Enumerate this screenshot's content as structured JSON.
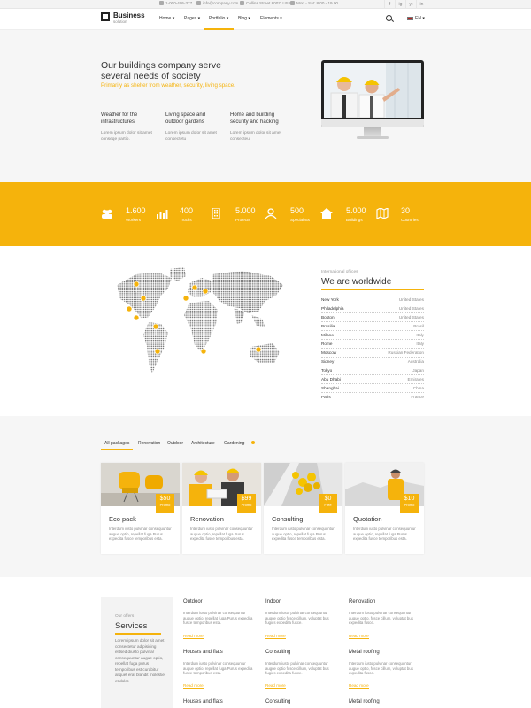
{
  "topbar": {
    "phone": "1-000-405-377",
    "email": "info@company.com",
    "address": "Collins Street 8007, USA",
    "hours": "Mon - Sat: 8.00 - 19.00",
    "social": [
      "f",
      "ig",
      "yt",
      "in"
    ]
  },
  "nav": {
    "logo_name": "Business",
    "logo_sub": "solution",
    "items": [
      "Home",
      "Pages",
      "Portfolio",
      "Blog",
      "Elements"
    ],
    "lang": "EN"
  },
  "hero": {
    "title": "Our buildings company serve several needs of society",
    "subtitle": "Primarily as shelter from weather, security, living space.",
    "features": [
      {
        "title": "Weather for the infrastructures",
        "text": "Lorem ipsum dolor sit amet conseqe partio."
      },
      {
        "title": "Living space and outdoor gardens",
        "text": "Lorem ipsum dolor sit amet consectetu"
      },
      {
        "title": "Home and building security and hacking",
        "text": "Lorem ipsum dolor sit amet consecteu"
      }
    ]
  },
  "stats": [
    {
      "value": "1.600",
      "label": "Workers"
    },
    {
      "value": "400",
      "label": "Trucks"
    },
    {
      "value": "5.000",
      "label": "Projects"
    },
    {
      "value": "500",
      "label": "Specialists"
    },
    {
      "value": "5.000",
      "label": "Buildings"
    },
    {
      "value": "30",
      "label": "Countries"
    }
  ],
  "offices": {
    "small": "International offices",
    "title": "We are worldwide",
    "rows": [
      {
        "city": "New York",
        "country": "United States"
      },
      {
        "city": "Philadelphia",
        "country": "United States"
      },
      {
        "city": "Boston",
        "country": "United States"
      },
      {
        "city": "Brasilia",
        "country": "Brasil"
      },
      {
        "city": "Milano",
        "country": "Italy"
      },
      {
        "city": "Rome",
        "country": "Italy"
      },
      {
        "city": "Moscow",
        "country": "Russian Federation"
      },
      {
        "city": "Sidney",
        "country": "Australia"
      },
      {
        "city": "Tokyo",
        "country": "Japan"
      },
      {
        "city": "Abu Dhabi",
        "country": "Emirates"
      },
      {
        "city": "Shanghai",
        "country": "China"
      },
      {
        "city": "Paris",
        "country": "France"
      }
    ]
  },
  "packages": {
    "tabs": [
      "All packages",
      "Renovation",
      "Outdoor",
      "Architecture",
      "Gardening"
    ],
    "cards": [
      {
        "title": "Eco pack",
        "price": "$50",
        "price_label": "Promo",
        "text": "Interdum iusto pulvinar consequuntur augue optio, repellat fuga Purus expedita fusce temporibus esta."
      },
      {
        "title": "Renovation",
        "price": "$99",
        "price_label": "Promo",
        "text": "Interdum iusto pulvinar consequuntur augue optio, repellat fuga Purus expedita fusce temporibus esta."
      },
      {
        "title": "Consulting",
        "price": "$0",
        "price_label": "Free",
        "text": "Interdum iusto pulvinar consequuntur augue optio, repellat fuga Purus expedita fusce temporibus esta."
      },
      {
        "title": "Quotation",
        "price": "$10",
        "price_label": "Promo",
        "text": "Interdum iusto pulvinar consequuntur augue optio, repellat fuga Purus expedita fusce temporibus esta."
      }
    ]
  },
  "services": {
    "small": "Our offers",
    "title": "Services",
    "text": "Lorem ipsum dolor sit amet consectetur adipisicing elitsed diusto pulvinar consequuntur augue optio, repellat fuga purus temporibus est curabitur aliquet erat blandit molestie et dolor.",
    "items": [
      {
        "title": "Outdoor",
        "text": "Interdum iusto pulvinar consequuntur augue optio, repellat fuga Purus expedita fusce temporibus esta.",
        "more": "Read more"
      },
      {
        "title": "Indoor",
        "text": "Interdum iusto pulvinar consequuntur augue optio fusce cillum, voluptat bus fugius expedita fusce.",
        "more": "Read more"
      },
      {
        "title": "Renovation",
        "text": "Interdum iusto pulvinar consequuntur augue optio, fusce cillum, voluptat bus expedita fusce.",
        "more": "Read more"
      },
      {
        "title": "Houses and flats",
        "text": "Interdum iusto pulvinar consequuntur augue optio, repellat fuga Purus expedita fusce temporibus esta.",
        "more": "Read more"
      },
      {
        "title": "Consulting",
        "text": "Interdum iusto pulvinar consequuntur augue optio fusce cillum, voluptat bus fugius expedita fusce.",
        "more": "Read more"
      },
      {
        "title": "Metal roofing",
        "text": "Interdum iusto pulvinar consequuntur augue optio, fusce cillum, voluptat bus expedita fusce.",
        "more": "Read more"
      },
      {
        "title": "Houses and flats",
        "text": "",
        "more": ""
      },
      {
        "title": "Consulting",
        "text": "",
        "more": ""
      },
      {
        "title": "Metal roofing",
        "text": "",
        "more": ""
      }
    ]
  },
  "colors": {
    "accent": "#f5b30c",
    "text": "#333333",
    "muted": "#888888",
    "light_bg": "#f6f6f6"
  }
}
